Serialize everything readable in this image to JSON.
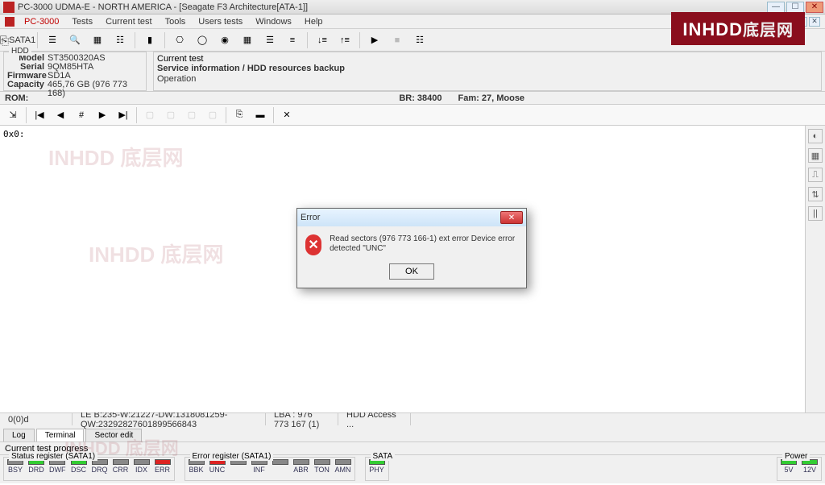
{
  "window": {
    "title": "PC-3000 UDMA-E - NORTH AMERICA - [Seagate F3 Architecture[ATA-1]]"
  },
  "menu": {
    "pc3000": "PC-3000",
    "items": [
      "Tests",
      "Current test",
      "Tools",
      "Users tests",
      "Windows",
      "Help"
    ]
  },
  "sata_label": "SATA1",
  "hdd": {
    "legend": "HDD",
    "model_lbl": "Model",
    "model": "ST3500320AS",
    "serial_lbl": "Serial",
    "serial": "9QM85HTA",
    "fw_lbl": "Firmware",
    "fw": "SD1A",
    "cap_lbl": "Capacity",
    "cap": "465,76 GB (976 773 168)"
  },
  "current_test": {
    "legend": "Current test",
    "service_label": "Service information / HDD resources backup",
    "operation_lbl": "Operation",
    "operation": ""
  },
  "rom": {
    "label": "ROM:",
    "br": "BR: 38400",
    "fam": "Fam: 27, Moose"
  },
  "content_addr": "0x0:",
  "status": {
    "cell1": "0(0)d",
    "cell2": "LE B:235-W:21227-DW:1318081259-QW:23292827601899566843",
    "cell3": "LBA : 976 773 167 (1)",
    "cell4": "HDD Access ..."
  },
  "tabs": {
    "log": "Log",
    "terminal": "Terminal",
    "sector": "Sector edit"
  },
  "progress_text": "Current test progress",
  "status_register": {
    "legend": "Status register (SATA1)",
    "items": [
      {
        "lbl": "BSY",
        "state": "gray"
      },
      {
        "lbl": "DRD",
        "state": "green"
      },
      {
        "lbl": "DWF",
        "state": "gray"
      },
      {
        "lbl": "DSC",
        "state": "green"
      },
      {
        "lbl": "DRQ",
        "state": "gray"
      },
      {
        "lbl": "CRR",
        "state": "gray"
      },
      {
        "lbl": "IDX",
        "state": "gray"
      },
      {
        "lbl": "ERR",
        "state": "red"
      }
    ]
  },
  "error_register": {
    "legend": "Error register (SATA1)",
    "items": [
      {
        "lbl": "BBK",
        "state": "gray"
      },
      {
        "lbl": "UNC",
        "state": "red"
      },
      {
        "lbl": "",
        "state": "gray"
      },
      {
        "lbl": "INF",
        "state": "gray"
      },
      {
        "lbl": "",
        "state": "gray"
      },
      {
        "lbl": "ABR",
        "state": "gray"
      },
      {
        "lbl": "TON",
        "state": "gray"
      },
      {
        "lbl": "AMN",
        "state": "gray"
      }
    ]
  },
  "sata_register": {
    "legend": "SATA",
    "items": [
      {
        "lbl": "PHY",
        "state": "green"
      }
    ]
  },
  "power_register": {
    "legend": "Power",
    "items": [
      {
        "lbl": "5V",
        "state": "green"
      },
      {
        "lbl": "12V",
        "state": "green"
      }
    ]
  },
  "dialog": {
    "title": "Error",
    "message": "Read sectors (976 773 166-1) ext error Device error detected \"UNC\"",
    "ok": "OK"
  },
  "watermark": "INHDD 底层网"
}
